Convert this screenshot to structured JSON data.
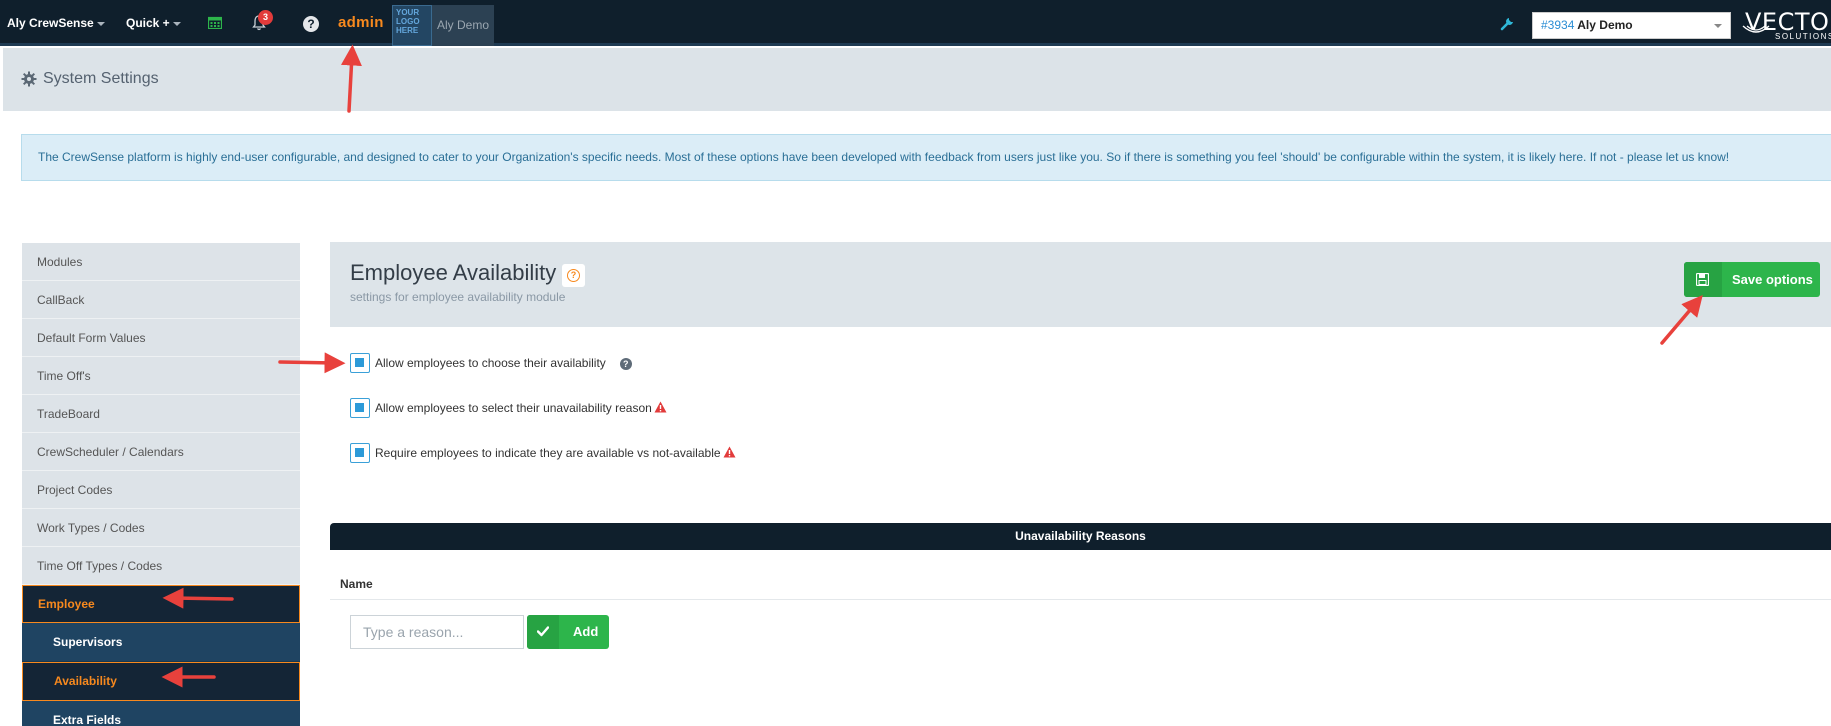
{
  "topnav": {
    "org_menu": "Aly CrewSense",
    "quick_menu": "Quick +",
    "notification_count": "3",
    "help_glyph": "?",
    "admin_label": "admin",
    "logo_placeholder": [
      "YOUR",
      "LOGO",
      "HERE"
    ],
    "account_name": "Aly Demo",
    "account_select": {
      "number": "#3934",
      "name": "Aly Demo"
    },
    "brand": {
      "name": "VECTOR",
      "sub": "SOLUTIONS"
    },
    "icons": [
      "calendar-icon",
      "bell-icon",
      "help-icon",
      "wrench-icon"
    ]
  },
  "page": {
    "title": "System Settings",
    "banner": "The CrewSense platform is highly end-user configurable, and designed to cater to your Organization's specific needs. Most of these options have been developed with feedback from users just like you. So if there is something you feel 'should' be configurable within the system, it is likely here. If not - please let us know!"
  },
  "sidebar": {
    "items": [
      "Modules",
      "CallBack",
      "Default Form Values",
      "Time Off's",
      "TradeBoard",
      "CrewScheduler / Calendars",
      "Project Codes",
      "Work Types / Codes",
      "Time Off Types / Codes"
    ],
    "active_item": "Employee",
    "subitems": [
      "Supervisors",
      "Availability",
      "Extra Fields"
    ],
    "active_subitem": "Availability"
  },
  "panel": {
    "title": "Employee Availability",
    "help_glyph": "?",
    "subtitle": "settings for employee availability module",
    "save_label": "Save options",
    "options": [
      {
        "label": "Allow employees to choose their availability",
        "checked": true,
        "icon": "question-icon"
      },
      {
        "label": "Allow employees to select their unavailability reason",
        "checked": true,
        "icon": "warning-icon"
      },
      {
        "label": "Require employees to indicate they are available vs not-available",
        "checked": true,
        "icon": "warning-icon"
      }
    ],
    "question_glyph": "?"
  },
  "reasons": {
    "header": "Unavailability Reasons",
    "column": "Name",
    "placeholder": "Type a reason...",
    "add_label": "Add"
  },
  "colors": {
    "nav_bg": "#0f1f2c",
    "accent_orange": "#f7891e",
    "success_green": "#2db54b",
    "checkbox_blue": "#2d9ad8",
    "annotation_red": "#e8413c"
  }
}
